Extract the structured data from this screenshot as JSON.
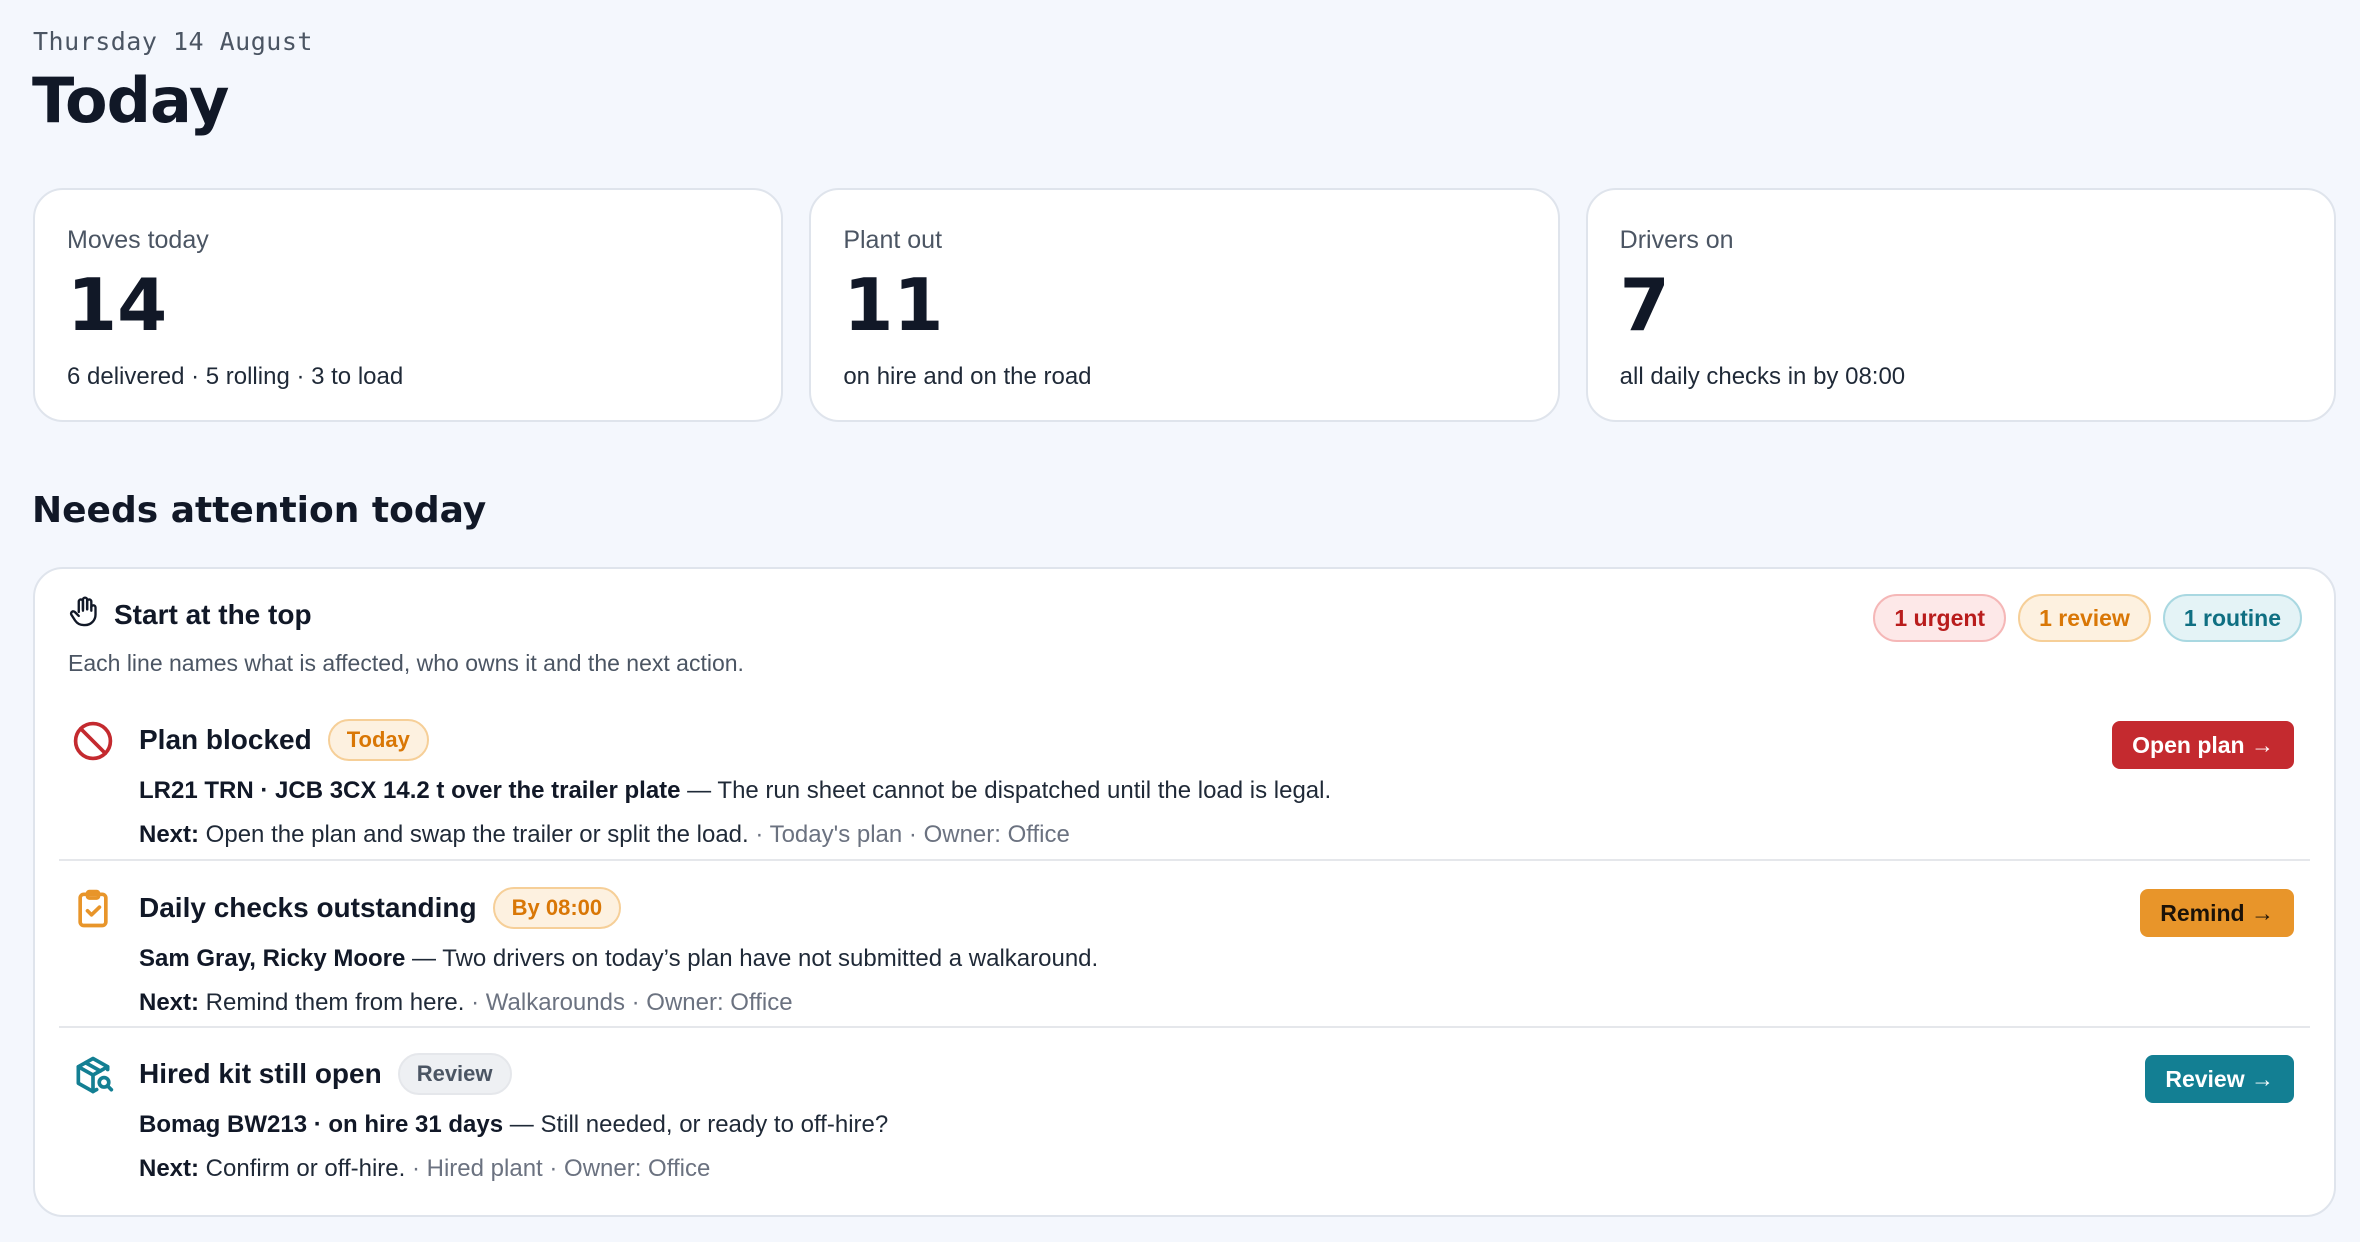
{
  "header": {
    "date": "Thursday 14 August",
    "title": "Today"
  },
  "stats": [
    {
      "label": "Moves today",
      "value": "14",
      "sub": "6 delivered · 5 rolling · 3 to load"
    },
    {
      "label": "Plant out",
      "value": "11",
      "sub": "on hire and on the road"
    },
    {
      "label": "Drivers on",
      "value": "7",
      "sub": "all daily checks in by 08:00"
    }
  ],
  "attention": {
    "section_title": "Needs attention today",
    "panel_title": "Start at the top",
    "panel_sub": "Each line names what is affected, who owns it and the next action.",
    "pills": {
      "urgent": "1 urgent",
      "review": "1 review",
      "routine": "1 routine"
    },
    "items": [
      {
        "icon": "blocked-icon",
        "title": "Plan blocked",
        "tag": "Today",
        "subject": "LR21 TRN · JCB 3CX 14.2 t over the trailer plate",
        "detail": " — The run sheet cannot be dispatched until the load is legal.",
        "next_label": "Next:",
        "next": " Open the plan and swap the trailer or split the load.",
        "meta": " · Today's plan · Owner: Office",
        "button": "Open plan →"
      },
      {
        "icon": "clipboard-check-icon",
        "title": "Daily checks outstanding",
        "tag": "By 08:00",
        "subject": "Sam Gray, Ricky Moore",
        "detail": " — Two drivers on today’s plan have not submitted a walkaround.",
        "next_label": "Next:",
        "next": " Remind them from here.",
        "meta": " · Walkarounds · Owner: Office",
        "button": "Remind →"
      },
      {
        "icon": "package-search-icon",
        "title": "Hired kit still open",
        "tag": "Review",
        "subject": "Bomag BW213 · on hire 31 days",
        "detail": " — Still needed, or ready to off-hire?",
        "next_label": "Next:",
        "next": " Confirm or off-hire.",
        "meta": " · Hired plant · Owner: Office",
        "button": "Review →"
      }
    ]
  },
  "colors": {
    "urgent": "#c42a2f",
    "review": "#e8952a",
    "routine": "#137f93",
    "background": "#f4f7fd"
  }
}
